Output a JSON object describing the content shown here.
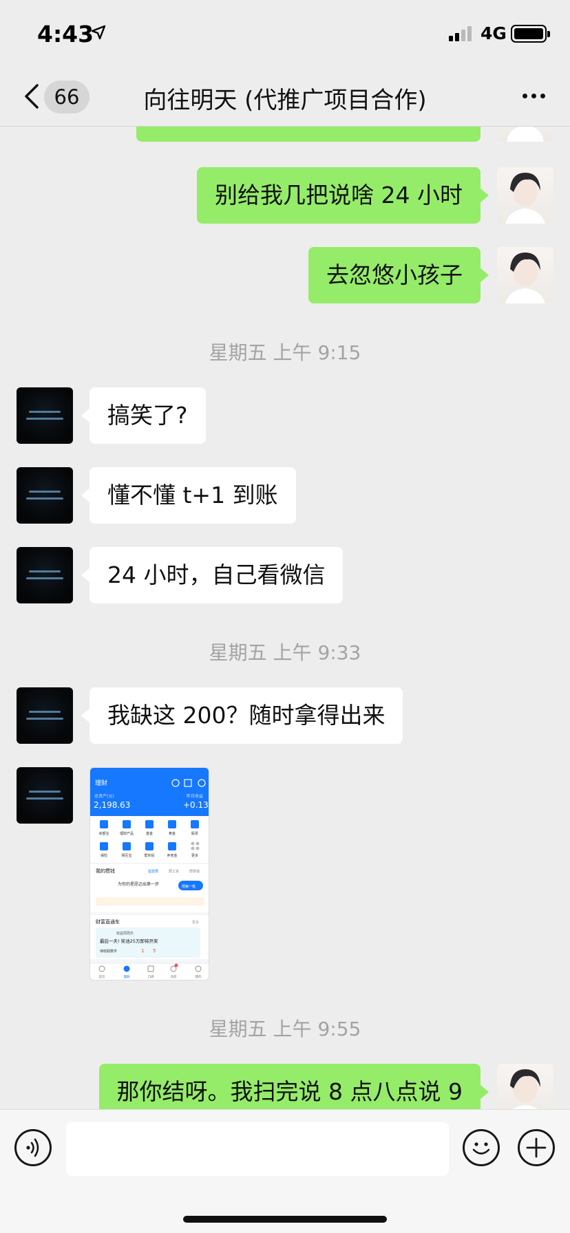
{
  "status_bar": {
    "time": "4:43",
    "network": "4G"
  },
  "nav": {
    "unread_count": "66",
    "title": "向往明天 (代推广项目合作)"
  },
  "messages": [
    {
      "type": "text",
      "side": "mine",
      "text": "别给我几把说啥 24 小时"
    },
    {
      "type": "text",
      "side": "mine",
      "text": "去忽悠小孩子"
    },
    {
      "type": "time",
      "text": "星期五 上午 9:15"
    },
    {
      "type": "text",
      "side": "theirs",
      "text": "搞笑了?"
    },
    {
      "type": "text",
      "side": "theirs",
      "text": "懂不懂 t+1 到账"
    },
    {
      "type": "text",
      "side": "theirs",
      "text": "24 小时，自己看微信"
    },
    {
      "type": "time",
      "text": "星期五 上午 9:33"
    },
    {
      "type": "text",
      "side": "theirs",
      "text": "我缺这 200？随时拿得出来"
    },
    {
      "type": "image",
      "side": "theirs"
    },
    {
      "type": "time",
      "text": "星期五 上午 9:55"
    },
    {
      "type": "text",
      "side": "mine",
      "text": "那你结呀。我扫完说 8 点八点说 9"
    }
  ],
  "screenshot_image": {
    "header_title": "理财",
    "total_label": "总资产(元)",
    "total_value": "2,198.63",
    "yesterday_label": "昨日收益",
    "yesterday_value": "+0.13",
    "grid_row1": [
      "余额宝",
      "理财产品",
      "基金",
      "黄金",
      "股票"
    ],
    "grid_row2": [
      "保险",
      "相互宝",
      "帮你投",
      "养老金",
      "更多"
    ],
    "section_title": "我的攒钱",
    "section_tabs": [
      "星愿攒",
      "攒工资",
      "攒零钱"
    ],
    "wish_text": "为你的星愿迈出第一步",
    "wish_button": "攒第一笔",
    "news_title": "财富直通车",
    "news_more": "更多",
    "promo_tag": "收益周周乐",
    "promo_text": "最后一天! 奖池25万即将开奖",
    "promo_sub": "待收取数字",
    "promo_digits": [
      "1",
      "5"
    ],
    "tabbar": [
      "首页",
      "理财",
      "口碑",
      "消息",
      "我的"
    ]
  },
  "input": {
    "placeholder": ""
  },
  "colors": {
    "my_bubble": "#95ec69",
    "their_bubble": "#ffffff",
    "background": "#ededed",
    "time_text": "#a3a3a3"
  }
}
